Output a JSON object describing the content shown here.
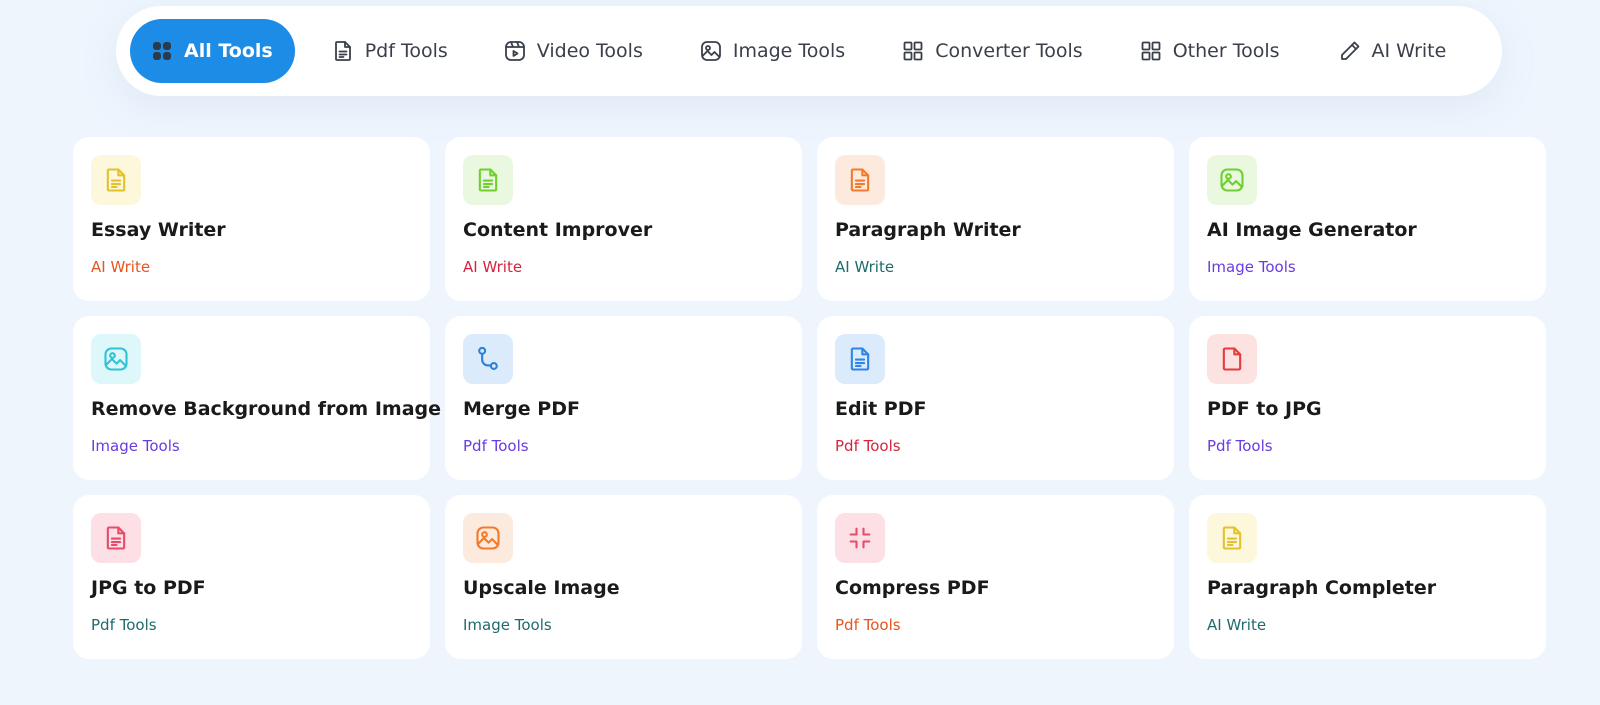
{
  "tabs": [
    {
      "label": "All Tools",
      "icon": "grid-dots-icon",
      "active": true
    },
    {
      "label": "Pdf Tools",
      "icon": "document-icon",
      "active": false
    },
    {
      "label": "Video Tools",
      "icon": "video-icon",
      "active": false
    },
    {
      "label": "Image Tools",
      "icon": "image-icon",
      "active": false
    },
    {
      "label": "Converter Tools",
      "icon": "grid-icon",
      "active": false
    },
    {
      "label": "Other Tools",
      "icon": "grid-icon",
      "active": false
    },
    {
      "label": "AI Write",
      "icon": "pencil-icon",
      "active": false
    }
  ],
  "colors": {
    "accent": "#1d8ce6",
    "background": "#eef5fd"
  },
  "cards": [
    {
      "title": "Essay Writer",
      "category": "AI Write",
      "category_color": "#e8541c",
      "icon": "document-icon",
      "icon_color": "#e3c12b",
      "icon_bg": "#fdf7dc"
    },
    {
      "title": "Content Improver",
      "category": "AI Write",
      "category_color": "#d8233d",
      "icon": "document-icon",
      "icon_color": "#6fcf30",
      "icon_bg": "#e9f8df"
    },
    {
      "title": "Paragraph Writer",
      "category": "AI Write",
      "category_color": "#1f6b6b",
      "icon": "document-icon",
      "icon_color": "#f27a2a",
      "icon_bg": "#fdeadf"
    },
    {
      "title": "AI Image Generator",
      "category": "Image Tools",
      "category_color": "#6a3be0",
      "icon": "image-icon",
      "icon_color": "#6fcf30",
      "icon_bg": "#e9f8df"
    },
    {
      "title": "Remove Background from Image",
      "category": "Image Tools",
      "category_color": "#6a3be0",
      "icon": "image-icon",
      "icon_color": "#2ec4d6",
      "icon_bg": "#def7fa"
    },
    {
      "title": "Merge PDF",
      "category": "Pdf Tools",
      "category_color": "#6a3be0",
      "icon": "merge-icon",
      "icon_color": "#2a7fd8",
      "icon_bg": "#dcebfb"
    },
    {
      "title": "Edit PDF",
      "category": "Pdf Tools",
      "category_color": "#d8233d",
      "icon": "document-icon",
      "icon_color": "#2a86e8",
      "icon_bg": "#dcebfb"
    },
    {
      "title": "PDF to JPG",
      "category": "Pdf Tools",
      "category_color": "#6a3be0",
      "icon": "file-icon",
      "icon_color": "#e63b3b",
      "icon_bg": "#fce3e1"
    },
    {
      "title": "JPG to PDF",
      "category": "Pdf Tools",
      "category_color": "#1f6b6b",
      "icon": "document-icon",
      "icon_color": "#e84a6a",
      "icon_bg": "#fde0e6"
    },
    {
      "title": "Upscale Image",
      "category": "Image Tools",
      "category_color": "#1f6b6b",
      "icon": "image-icon",
      "icon_color": "#f27a2a",
      "icon_bg": "#fdeadf"
    },
    {
      "title": "Compress PDF",
      "category": "Pdf Tools",
      "category_color": "#e8541c",
      "icon": "compress-icon",
      "icon_color": "#e84a6a",
      "icon_bg": "#fde0e6"
    },
    {
      "title": "Paragraph Completer",
      "category": "AI Write",
      "category_color": "#1f6b6b",
      "icon": "document-icon",
      "icon_color": "#e3c12b",
      "icon_bg": "#fdf7dc"
    }
  ]
}
